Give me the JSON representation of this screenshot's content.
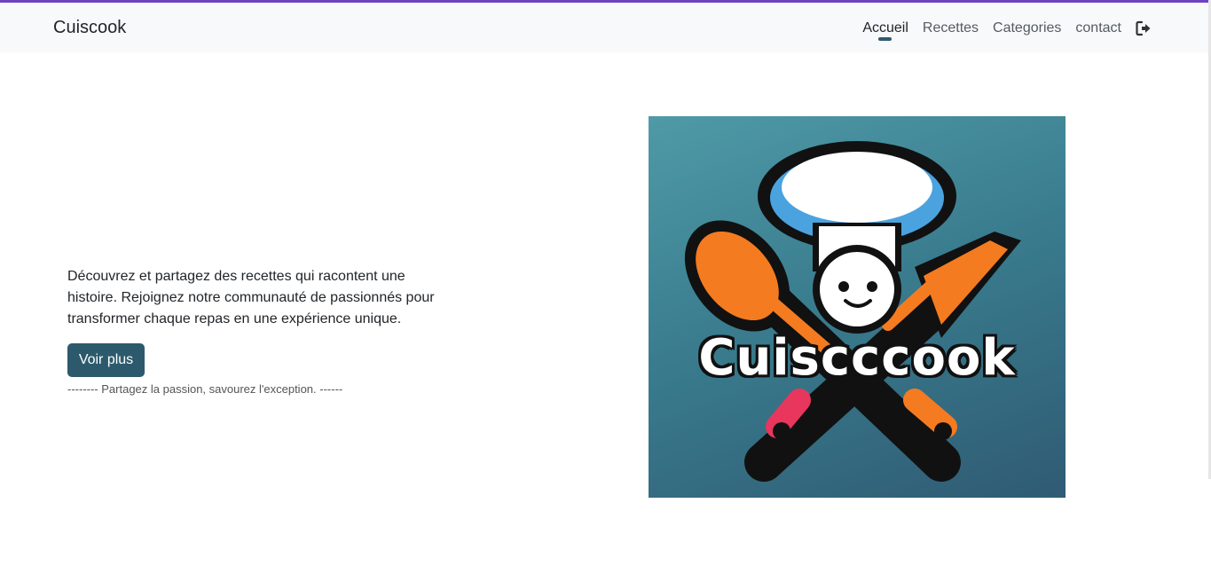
{
  "brand": "Cuiscook",
  "nav": {
    "items": [
      {
        "label": "Accueil",
        "active": true
      },
      {
        "label": "Recettes",
        "active": false
      },
      {
        "label": "Categories",
        "active": false
      },
      {
        "label": "contact",
        "active": false
      }
    ],
    "logout_icon": "sign-out-icon"
  },
  "hero": {
    "description": "Découvrez et partagez des recettes qui racontent une histoire. Rejoignez notre communauté de passionnés pour transformer chaque repas en une expérience unique.",
    "cta_label": "Voir plus",
    "tagline": "-------- Partagez la passion, savourez l'exception. ------"
  },
  "logo": {
    "wordmark": "Cuiscccook"
  },
  "colors": {
    "accent": "#2c5a6c",
    "top_bar": "#6f42c1",
    "navbar_bg": "#f8f9fa"
  }
}
